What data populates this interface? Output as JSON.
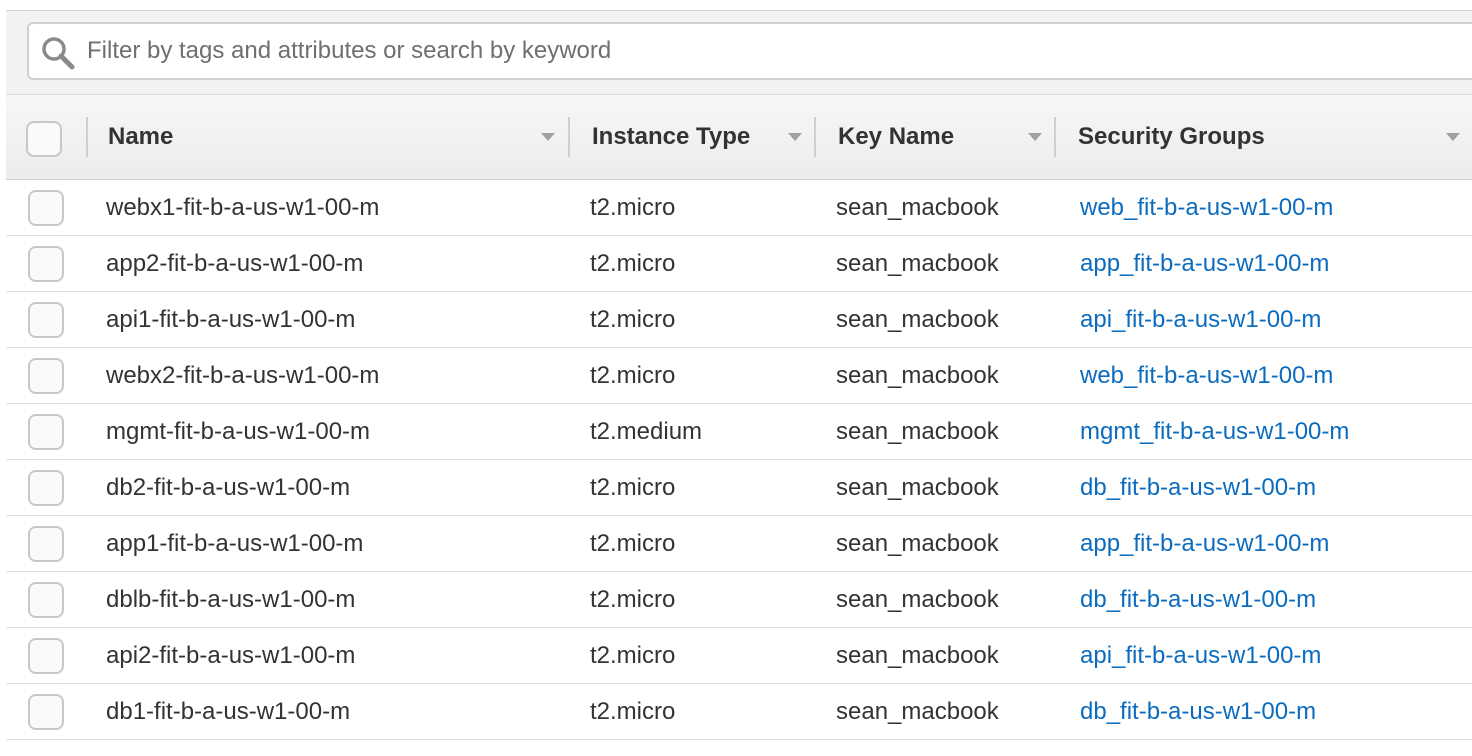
{
  "search": {
    "placeholder": "Filter by tags and attributes or search by keyword"
  },
  "table": {
    "columns": [
      {
        "label": "Name"
      },
      {
        "label": "Instance Type"
      },
      {
        "label": "Key Name"
      },
      {
        "label": "Security Groups"
      }
    ],
    "rows": [
      {
        "name": "webx1-fit-b-a-us-w1-00-m",
        "type": "t2.micro",
        "key": "sean_macbook",
        "sg": "web_fit-b-a-us-w1-00-m"
      },
      {
        "name": "app2-fit-b-a-us-w1-00-m",
        "type": "t2.micro",
        "key": "sean_macbook",
        "sg": "app_fit-b-a-us-w1-00-m"
      },
      {
        "name": "api1-fit-b-a-us-w1-00-m",
        "type": "t2.micro",
        "key": "sean_macbook",
        "sg": "api_fit-b-a-us-w1-00-m"
      },
      {
        "name": "webx2-fit-b-a-us-w1-00-m",
        "type": "t2.micro",
        "key": "sean_macbook",
        "sg": "web_fit-b-a-us-w1-00-m"
      },
      {
        "name": "mgmt-fit-b-a-us-w1-00-m",
        "type": "t2.medium",
        "key": "sean_macbook",
        "sg": "mgmt_fit-b-a-us-w1-00-m"
      },
      {
        "name": "db2-fit-b-a-us-w1-00-m",
        "type": "t2.micro",
        "key": "sean_macbook",
        "sg": "db_fit-b-a-us-w1-00-m"
      },
      {
        "name": "app1-fit-b-a-us-w1-00-m",
        "type": "t2.micro",
        "key": "sean_macbook",
        "sg": "app_fit-b-a-us-w1-00-m"
      },
      {
        "name": "dblb-fit-b-a-us-w1-00-m",
        "type": "t2.micro",
        "key": "sean_macbook",
        "sg": "db_fit-b-a-us-w1-00-m"
      },
      {
        "name": "api2-fit-b-a-us-w1-00-m",
        "type": "t2.micro",
        "key": "sean_macbook",
        "sg": "api_fit-b-a-us-w1-00-m"
      },
      {
        "name": "db1-fit-b-a-us-w1-00-m",
        "type": "t2.micro",
        "key": "sean_macbook",
        "sg": "db_fit-b-a-us-w1-00-m"
      }
    ]
  },
  "colors": {
    "link": "#0b6cbf",
    "header_bg": "#ececec",
    "text": "#333333"
  }
}
